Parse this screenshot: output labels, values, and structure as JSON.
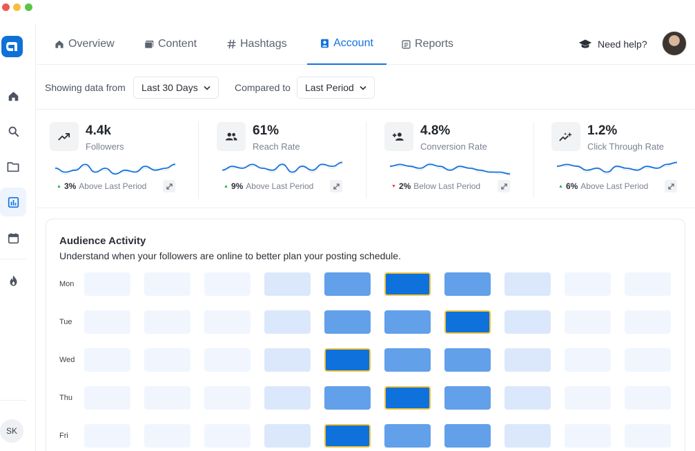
{
  "window": {
    "buttons": [
      "close",
      "minimize",
      "maximize"
    ]
  },
  "sidebar": {
    "items": [
      {
        "name": "home",
        "icon": "home-icon",
        "active": false
      },
      {
        "name": "search",
        "icon": "search-icon",
        "active": false
      },
      {
        "name": "folder",
        "icon": "folder-icon",
        "active": false
      },
      {
        "name": "analytics",
        "icon": "bar-chart-icon",
        "active": true
      },
      {
        "name": "calendar",
        "icon": "calendar-icon",
        "active": false
      },
      {
        "name": "trending",
        "icon": "flame-icon",
        "active": false
      }
    ],
    "user_initials": "SK"
  },
  "nav": {
    "tabs": [
      {
        "label": "Overview",
        "icon": "home-icon",
        "active": false
      },
      {
        "label": "Content",
        "icon": "image-icon",
        "active": false
      },
      {
        "label": "Hashtags",
        "icon": "hash-icon",
        "active": false
      },
      {
        "label": "Account",
        "icon": "account-icon",
        "active": true
      },
      {
        "label": "Reports",
        "icon": "report-icon",
        "active": false
      }
    ],
    "help_label": "Need help?"
  },
  "filters": {
    "showing_label": "Showing data from",
    "range_value": "Last 30 Days",
    "compared_label": "Compared to",
    "compare_value": "Last Period"
  },
  "metrics": [
    {
      "value": "4.4k",
      "label": "Followers",
      "change": "3%",
      "direction": "up",
      "change_text": "Above Last Period",
      "icon": "trend-up-icon",
      "trend": [
        5,
        7,
        6,
        3,
        7,
        5,
        8,
        6,
        7,
        4,
        6,
        5,
        3
      ]
    },
    {
      "value": "61%",
      "label": "Reach Rate",
      "change": "9%",
      "direction": "up",
      "change_text": "Above Last Period",
      "icon": "users-icon",
      "trend": [
        6,
        4,
        5,
        3,
        5,
        6,
        3,
        7,
        4,
        6,
        3,
        4,
        2
      ]
    },
    {
      "value": "4.8%",
      "label": "Conversion Rate",
      "change": "2%",
      "direction": "down",
      "change_text": "Below Last Period",
      "icon": "add-user-icon",
      "trend": [
        4,
        3,
        4,
        5,
        3,
        4,
        6,
        4,
        5,
        6,
        7,
        7,
        8
      ]
    },
    {
      "value": "1.2%",
      "label": "Click Through Rate",
      "change": "6%",
      "direction": "up",
      "change_text": "Above Last Period",
      "icon": "sparkle-icon",
      "trend": [
        4,
        3,
        4,
        6,
        5,
        7,
        4,
        5,
        6,
        4,
        5,
        3,
        2
      ]
    }
  ],
  "colors": {
    "accent": "#1272dd",
    "up": "#2aa84a",
    "down": "#e0413b",
    "heat_levels": [
      "#f1f6fe",
      "#dbe8fb",
      "#62a0ea",
      "#0f71dc"
    ],
    "peak_outline": "#f1c33c"
  },
  "audience": {
    "title": "Audience Activity",
    "subtitle": "Understand when your followers are online to better plan your posting schedule.",
    "days": [
      "Mon",
      "Tue",
      "Wed",
      "Thu",
      "Fri"
    ],
    "levels": [
      [
        1,
        1,
        1,
        2,
        3,
        4,
        3,
        2,
        1,
        1
      ],
      [
        1,
        1,
        1,
        2,
        3,
        3,
        4,
        2,
        1,
        1
      ],
      [
        1,
        1,
        1,
        2,
        4,
        3,
        3,
        2,
        1,
        1
      ],
      [
        1,
        1,
        1,
        2,
        3,
        4,
        3,
        2,
        1,
        1
      ],
      [
        1,
        1,
        1,
        2,
        4,
        3,
        3,
        2,
        1,
        1
      ]
    ]
  }
}
